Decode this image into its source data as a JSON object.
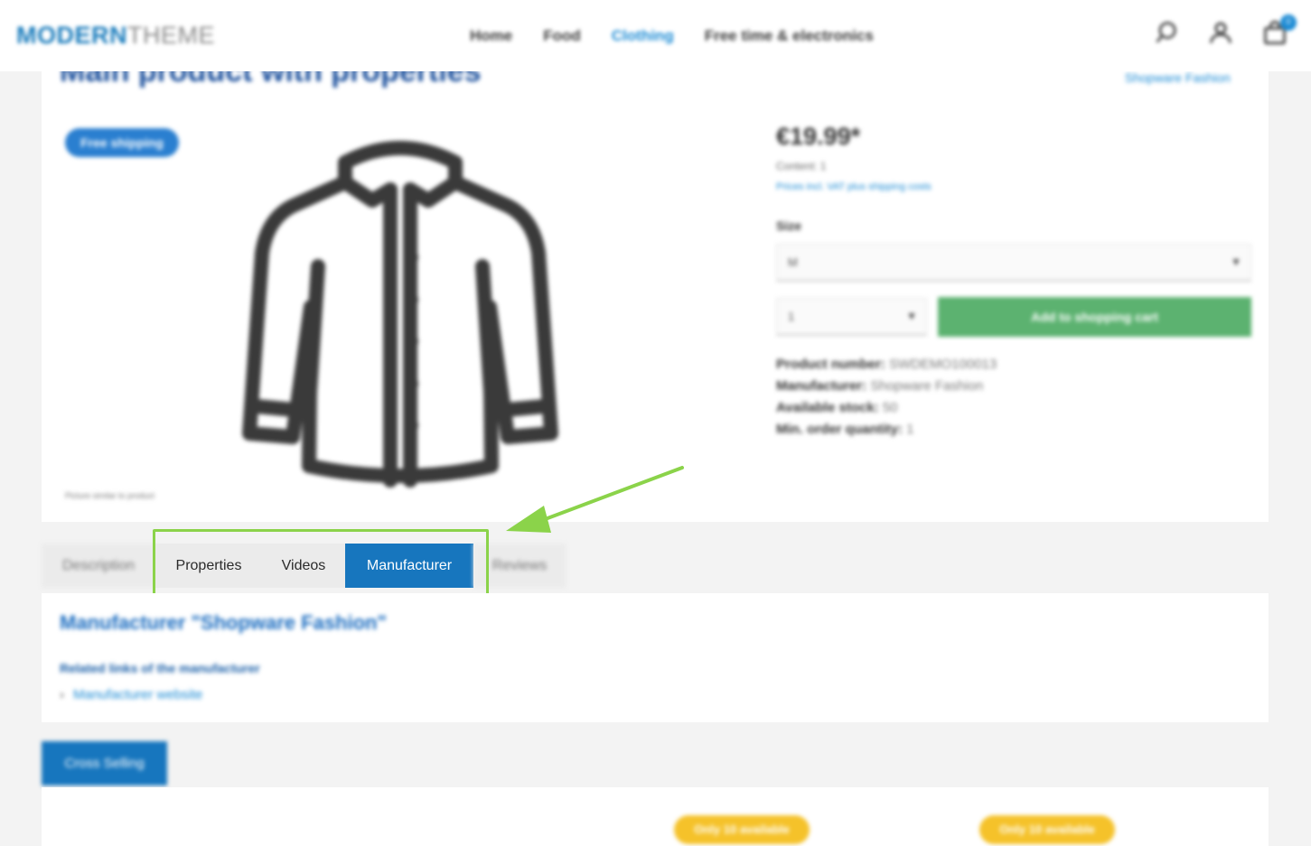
{
  "header": {
    "logo_part1": "MODERN",
    "logo_part2": "THEME",
    "nav": [
      "Home",
      "Food",
      "Clothing",
      "Free time & electronics"
    ],
    "cart_count": "0"
  },
  "product": {
    "title": "Main product with properties",
    "brand_link": "Shopware Fashion",
    "badge": "Free shipping",
    "image_caption": "Picture similar to product",
    "price": "€19.99*",
    "content": "Content: 1",
    "vat_note": "Prices incl. VAT plus shipping costs",
    "size_label": "Size",
    "size_value": "M",
    "quantity_value": "1",
    "add_to_cart": "Add to shopping cart",
    "meta": [
      {
        "key": "Product number:",
        "value": "SWDEMO100013"
      },
      {
        "key": "Manufacturer:",
        "value": "Shopware Fashion"
      },
      {
        "key": "Available stock:",
        "value": "50"
      },
      {
        "key": "Min. order quantity:",
        "value": "1"
      }
    ]
  },
  "tabs": {
    "description": "Description",
    "properties": "Properties",
    "videos": "Videos",
    "manufacturer": "Manufacturer",
    "reviews": "Reviews"
  },
  "manufacturer_panel": {
    "title": "Manufacturer \"Shopware Fashion\"",
    "related_links": "Related links of the manufacturer",
    "website_link": "Manufacturer website"
  },
  "cross_selling": {
    "tab_label": "Cross Selling",
    "badge_1": "Only 10 available",
    "badge_2": "Only 10 available"
  },
  "colors": {
    "accent": "#1776be",
    "highlight": "#8bd34a",
    "add_to_cart": "#5cb270",
    "availability": "#f5c22a"
  }
}
